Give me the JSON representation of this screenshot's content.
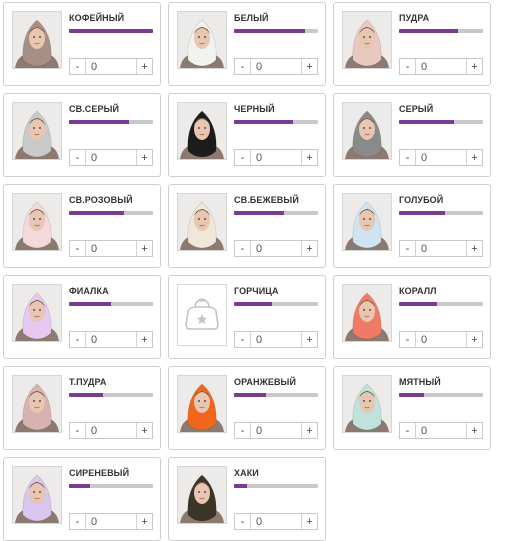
{
  "items": [
    {
      "name": "КОФЕЙНЫЙ",
      "color": "#a88f86",
      "image": "photo",
      "stock_fraction": 1.0,
      "qty": "0"
    },
    {
      "name": "БЕЛЫЙ",
      "color": "#f2f2ef",
      "image": "photo",
      "stock_fraction": 0.85,
      "qty": "0"
    },
    {
      "name": "ПУДРА",
      "color": "#e9c8c0",
      "image": "photo",
      "stock_fraction": 0.7,
      "qty": "0"
    },
    {
      "name": "СВ.СЕРЫЙ",
      "color": "#c9c9c9",
      "image": "photo",
      "stock_fraction": 0.72,
      "qty": "0"
    },
    {
      "name": "ЧЕРНЫЙ",
      "color": "#1c1c1c",
      "image": "photo",
      "stock_fraction": 0.7,
      "qty": "0"
    },
    {
      "name": "СЕРЫЙ",
      "color": "#8a8a8a",
      "image": "photo",
      "stock_fraction": 0.65,
      "qty": "0"
    },
    {
      "name": "СВ.РОЗОВЫЙ",
      "color": "#f3d9dc",
      "image": "photo",
      "stock_fraction": 0.65,
      "qty": "0"
    },
    {
      "name": "СВ.БЕЖЕВЫЙ",
      "color": "#efe7da",
      "image": "photo",
      "stock_fraction": 0.6,
      "qty": "0"
    },
    {
      "name": "ГОЛУБОЙ",
      "color": "#cfe3f2",
      "image": "photo",
      "stock_fraction": 0.55,
      "qty": "0"
    },
    {
      "name": "ФИАЛКА",
      "color": "#e7c9ef",
      "image": "photo",
      "stock_fraction": 0.5,
      "qty": "0"
    },
    {
      "name": "ГОРЧИЦА",
      "color": "#ffffff",
      "image": "placeholder",
      "stock_fraction": 0.45,
      "qty": "0"
    },
    {
      "name": "КОРАЛЛ",
      "color": "#ef7b66",
      "image": "photo",
      "stock_fraction": 0.45,
      "qty": "0"
    },
    {
      "name": "Т.ПУДРА",
      "color": "#d6b2b0",
      "image": "photo",
      "stock_fraction": 0.4,
      "qty": "0"
    },
    {
      "name": "ОРАНЖЕВЫЙ",
      "color": "#f0661a",
      "image": "photo",
      "stock_fraction": 0.38,
      "qty": "0"
    },
    {
      "name": "МЯТНЫЙ",
      "color": "#bfe3dc",
      "image": "photo",
      "stock_fraction": 0.3,
      "qty": "0"
    },
    {
      "name": "СИРЕНЕВЫЙ",
      "color": "#d9c6ef",
      "image": "photo",
      "stock_fraction": 0.25,
      "qty": "0"
    },
    {
      "name": "ХАКИ",
      "color": "#3a3527",
      "image": "photo",
      "stock_fraction": 0.15,
      "qty": "0"
    }
  ],
  "controls": {
    "minus_label": "-",
    "plus_label": "+"
  },
  "colors": {
    "accent": "#7a3b8e",
    "track": "#c8c8c8",
    "border": "#cfcfcf"
  }
}
